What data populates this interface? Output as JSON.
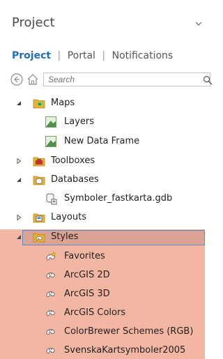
{
  "panel": {
    "title": "Project"
  },
  "tabs": [
    {
      "label": "Project",
      "active": true
    },
    {
      "label": "Portal",
      "active": false
    },
    {
      "label": "Notifications",
      "active": false
    }
  ],
  "search": {
    "placeholder": "Search"
  },
  "tree": {
    "maps": {
      "label": "Maps",
      "children": [
        "Layers",
        "New Data Frame"
      ]
    },
    "toolboxes": {
      "label": "Toolboxes"
    },
    "databases": {
      "label": "Databases",
      "children": [
        "Symboler_fastkarta.gdb"
      ]
    },
    "layouts": {
      "label": "Layouts"
    },
    "styles": {
      "label": "Styles",
      "children": [
        "Favorites",
        "ArcGIS 2D",
        "ArcGIS 3D",
        "ArcGIS Colors",
        "ColorBrewer Schemes (RGB)",
        "SvenskaKartsymboler2005"
      ]
    }
  },
  "colors": {
    "accent": "#1d6fb8",
    "selection_band": "#f2b6a3",
    "selected_row": "#dba393",
    "selected_border": "#5a8cc8",
    "folder": "#d8a321"
  }
}
